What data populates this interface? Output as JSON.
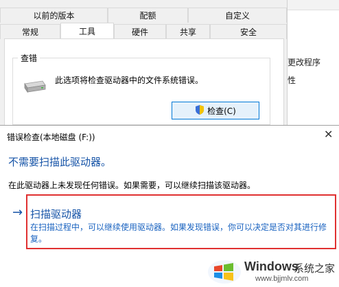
{
  "props": {
    "tabs_row1": [
      {
        "label": "以前的版本",
        "width": 157
      },
      {
        "label": "配额",
        "width": 117
      },
      {
        "label": "自定义",
        "width": 144
      }
    ],
    "tabs_row2": [
      {
        "label": "常规",
        "width": 88,
        "active": false
      },
      {
        "label": "工具",
        "width": 78,
        "active": true
      },
      {
        "label": "硬件",
        "width": 76,
        "active": false
      },
      {
        "label": "共享",
        "width": 64,
        "active": false
      },
      {
        "label": "安全",
        "width": 112,
        "active": false
      }
    ],
    "group_title": "查错",
    "group_desc": "此选项将检查驱动器中的文件系统错误。",
    "check_button": "检查(C)"
  },
  "right_window": {
    "text1": "更改程序",
    "text2": "性"
  },
  "dialog": {
    "title": "错误检查(本地磁盘 (F:))",
    "close": "✕",
    "heading": "不需要扫描此驱动器。",
    "body": "在此驱动器上未发现任何错误。如果需要，可以继续扫描该驱动器。",
    "option_arrow": "→",
    "option_title": "扫描驱动器",
    "option_desc": "在扫描过程中，可以继续使用驱动器。如果发现错误，你可以决定是否对其进行修复。"
  },
  "watermark": {
    "brand": "Windows",
    "cn": "系统之家",
    "url": "www.bjjmlv.com"
  },
  "colors": {
    "accent": "#1553a7",
    "highlight_border": "#e03030",
    "button_border": "#0078d7"
  }
}
